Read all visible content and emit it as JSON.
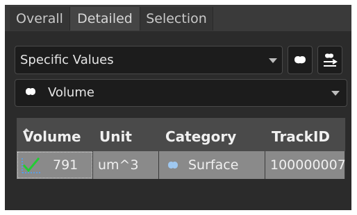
{
  "tabs": {
    "overall": "Overall",
    "detailed": "Detailed",
    "selection": "Selection"
  },
  "values_combo": {
    "label": "Specific Values"
  },
  "measure_combo": {
    "label": "Volume"
  },
  "table": {
    "headers": [
      "Volume",
      "Unit",
      "Category",
      "TrackID"
    ],
    "rows": [
      {
        "volume": "791",
        "unit": "um^3",
        "category": "Surface",
        "trackid": "100000007"
      }
    ]
  },
  "colors": {
    "panel": "#2b2b2b",
    "header": "#4a4a4a",
    "row": "#8a8a8a",
    "check": "#22cc33"
  }
}
